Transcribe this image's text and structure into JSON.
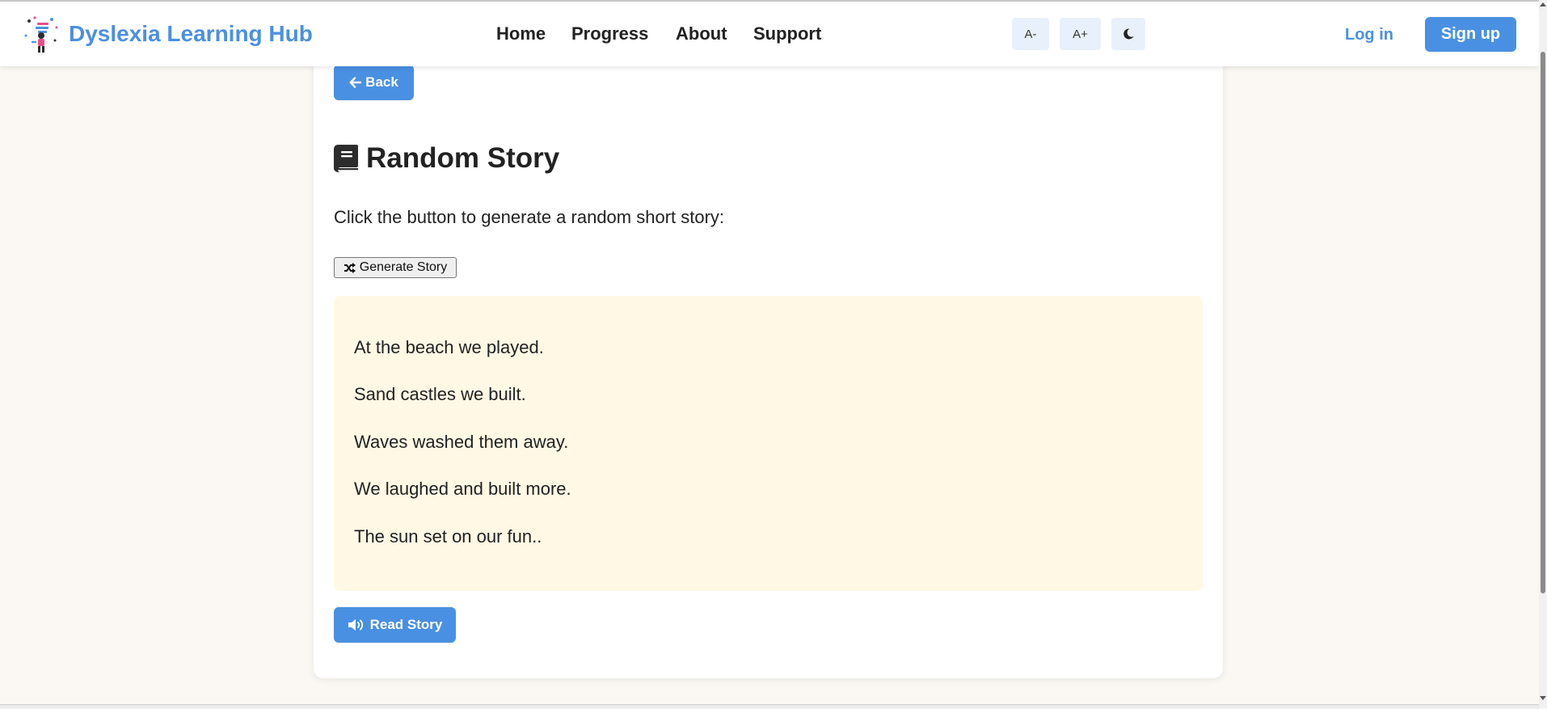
{
  "header": {
    "brand": "Dyslexia Learning Hub",
    "nav": [
      "Home",
      "Progress",
      "About",
      "Support"
    ],
    "font_decrease": "A-",
    "font_increase": "A+",
    "login": "Log in",
    "signup": "Sign up"
  },
  "main": {
    "back_label": "Back",
    "title": "Random Story",
    "intro": "Click the button to generate a random short story:",
    "generate_label": "Generate Story",
    "story_lines": [
      "At the beach we played.",
      "Sand castles we built.",
      "Waves washed them away.",
      "We laughed and built more.",
      "The sun set on our fun.."
    ],
    "read_label": "Read Story"
  },
  "colors": {
    "accent": "#4a90e2",
    "page_background": "#fbf8f3",
    "story_background": "#fff8e5",
    "tool_button_background": "#e8f1fb"
  },
  "icons": {
    "back": "arrow-left-icon",
    "title": "book-icon",
    "generate": "shuffle-icon",
    "read": "volume-icon",
    "theme": "moon-icon"
  }
}
